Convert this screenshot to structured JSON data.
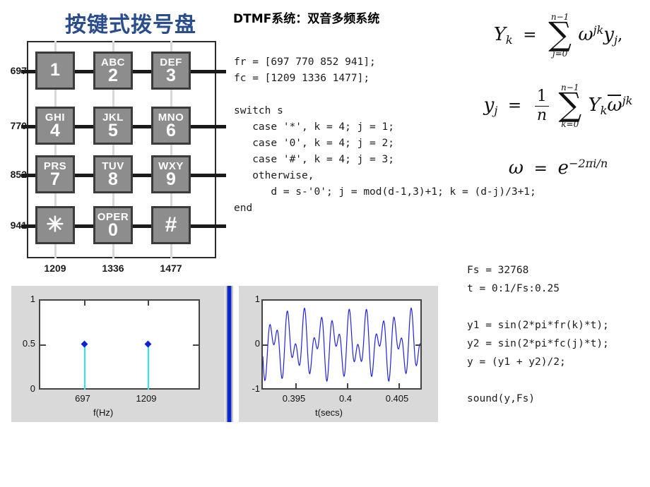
{
  "slide": {
    "keypad_title": "按键式拨号盘",
    "dtmf_heading": "DTMF系统：双音多频系统"
  },
  "keypad": {
    "row_freqs": [
      "697",
      "770",
      "852",
      "941"
    ],
    "col_freqs": [
      "1209",
      "1336",
      "1477"
    ],
    "keys": [
      {
        "letters": "",
        "digit": "1"
      },
      {
        "letters": "ABC",
        "digit": "2"
      },
      {
        "letters": "DEF",
        "digit": "3"
      },
      {
        "letters": "GHI",
        "digit": "4"
      },
      {
        "letters": "JKL",
        "digit": "5"
      },
      {
        "letters": "MNO",
        "digit": "6"
      },
      {
        "letters": "PRS",
        "digit": "7"
      },
      {
        "letters": "TUV",
        "digit": "8"
      },
      {
        "letters": "WXY",
        "digit": "9"
      },
      {
        "letters": "",
        "digit": "✳"
      },
      {
        "letters": "OPER",
        "digit": "0"
      },
      {
        "letters": "",
        "digit": "#"
      }
    ]
  },
  "code": {
    "main": "fr = [697 770 852 941];\nfc = [1209 1336 1477];\n\nswitch s\n   case '*', k = 4; j = 1;\n   case '0', k = 4; j = 2;\n   case '#', k = 4; j = 3;\n   otherwise,\n      d = s-'0'; j = mod(d-1,3)+1; k = (d-j)/3+1;\nend",
    "sound": "Fs = 32768\nt = 0:1/Fs:0.25\n\ny1 = sin(2*pi*fr(k)*t);\ny2 = sin(2*pi*fc(j)*t);\ny = (y1 + y2)/2;\n\nsound(y,Fs)"
  },
  "equations": {
    "dft": "Y_k = sum_{j=0}^{n-1} w^{jk} y_j,",
    "idft": "y_j = (1/n) sum_{k=0}^{n-1} Y_k wbar^{jk}",
    "omega": "w = e^{-2*pi*i/n}"
  },
  "chart_data": [
    {
      "type": "bar",
      "name": "spectrum",
      "title": "",
      "xlabel": "f(Hz)",
      "ylabel": "",
      "x": [
        697,
        1209
      ],
      "values": [
        0.5,
        0.5
      ],
      "xtick_labels": [
        "697",
        "1209"
      ],
      "ytick_labels": [
        "0",
        "0.5",
        "1"
      ],
      "xlim": [
        500,
        1800
      ],
      "ylim": [
        0,
        1
      ],
      "grid": false,
      "legend": "none",
      "series_color": "#28e8f5",
      "marker_color": "#1020d8"
    },
    {
      "type": "line",
      "name": "waveform",
      "title": "",
      "xlabel": "t(secs)",
      "ylabel": "",
      "xtick_labels": [
        "0.395",
        "0.4",
        "0.405"
      ],
      "ytick_labels": [
        "-1",
        "0",
        "1"
      ],
      "xlim": [
        0.3925,
        0.4072
      ],
      "ylim": [
        -1,
        1
      ],
      "grid": false,
      "legend": "none",
      "series_color": "#2222dd",
      "description": "Sum of two sinusoids 697 Hz and 1209 Hz, amplitude ~0.8 envelope beating"
    }
  ]
}
